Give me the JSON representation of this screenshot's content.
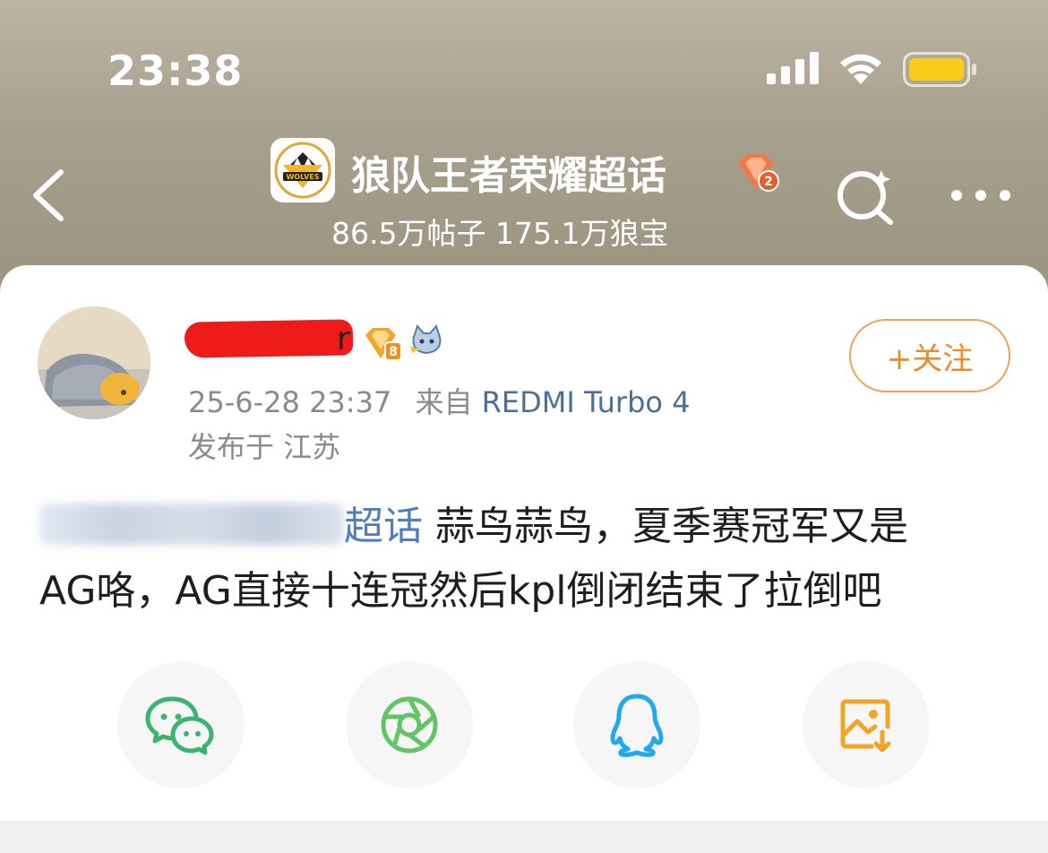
{
  "status_bar": {
    "time": "23:38",
    "signal_icon": "cellular-signal-icon",
    "wifi_icon": "wifi-icon",
    "battery_icon": "battery-icon",
    "battery_color": "#f7cd19"
  },
  "header": {
    "title": "狼队王者荣耀超话",
    "stats": "86.5万帖子 175.1万狼宝",
    "logo_text": "WOLVES",
    "level_badge": "2",
    "background_color": "#a8a08e"
  },
  "post": {
    "username_tail": "r",
    "user_level": "8",
    "timestamp": "25-6-28 23:37",
    "source_prefix": "来自",
    "device": "REDMI Turbo 4",
    "location": "发布于 江苏",
    "follow_label": "+关注",
    "topic_tag": "超话",
    "body_line1": " 蒜鸟蒜鸟，夏季赛冠军又是",
    "body_line2": "AG咯，AG直接十连冠然后kpl倒闭结束了拉倒吧"
  },
  "share": {
    "buttons": [
      {
        "name": "wechat",
        "icon": "wechat-icon",
        "color": "#3cb371"
      },
      {
        "name": "moments",
        "icon": "moments-icon",
        "color": "#62c466"
      },
      {
        "name": "qq",
        "icon": "qq-icon",
        "color": "#21a8f0"
      },
      {
        "name": "save-image",
        "icon": "save-image-icon",
        "color": "#f0a524"
      }
    ]
  },
  "accent_colors": {
    "follow": "#ef8a2a",
    "link": "#4f7fb8"
  }
}
